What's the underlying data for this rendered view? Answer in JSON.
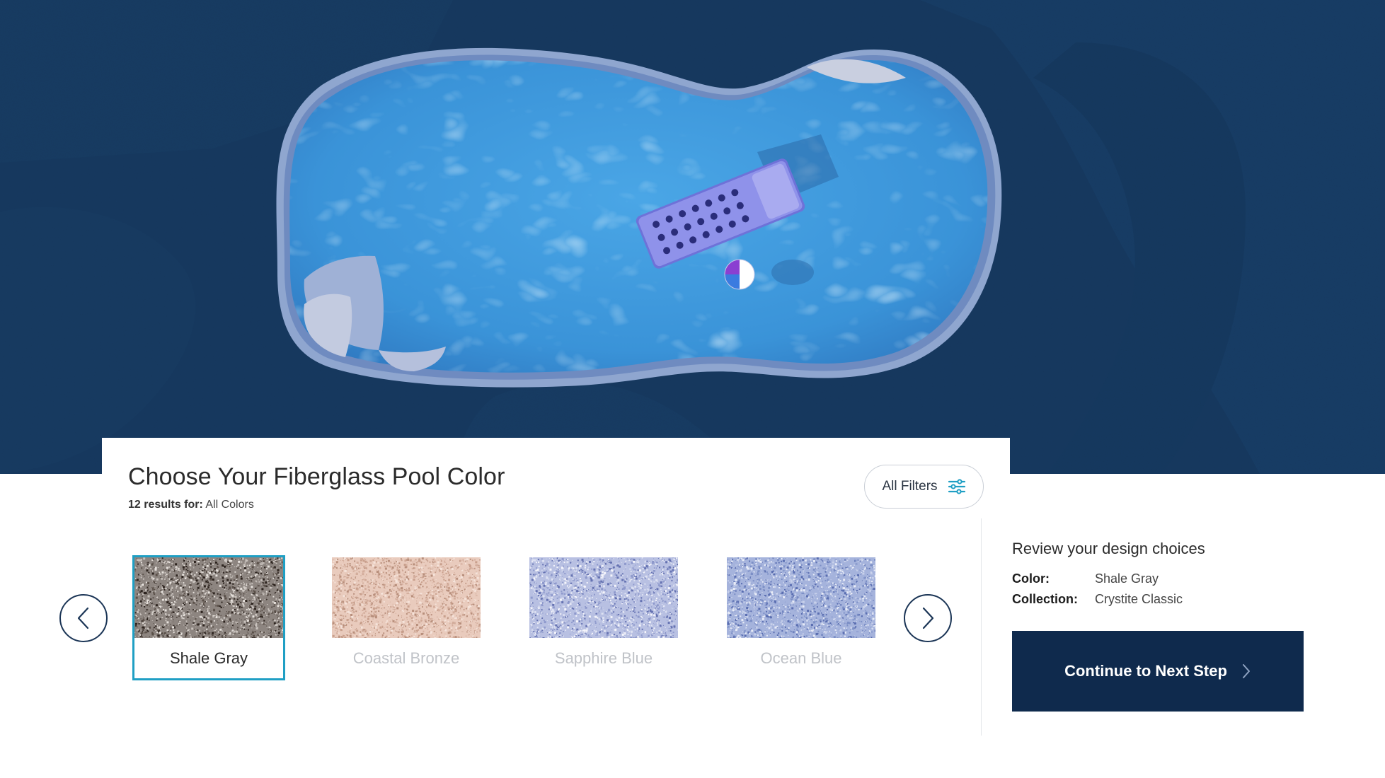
{
  "hero": {
    "image": "fiberglass-pool-aerial-view",
    "background_color": "#163a61"
  },
  "header": {
    "title": "Choose Your Fiberglass Pool Color",
    "results_count_label": "12 results for:",
    "results_filter_value": "All Colors",
    "filters_button_label": "All Filters",
    "filters_icon": "sliders-icon"
  },
  "carousel": {
    "prev_icon": "chevron-left-icon",
    "next_icon": "chevron-right-icon",
    "selected_border_color": "#1f9fc4",
    "swatches": [
      {
        "label": "Shale Gray",
        "selected": true,
        "colors": [
          "#2e2520",
          "#5a5049",
          "#8d8580",
          "#c9c2bd",
          "#e6e1dc"
        ]
      },
      {
        "label": "Coastal Bronze",
        "selected": false,
        "colors": [
          "#b88f7c",
          "#d3ad9c",
          "#e9cbbd",
          "#f5e3da",
          "#c9a08d"
        ]
      },
      {
        "label": "Sapphire Blue",
        "selected": false,
        "colors": [
          "#6673b2",
          "#8e99cc",
          "#b8c0e2",
          "#dde1f2",
          "#f5f5fb"
        ]
      },
      {
        "label": "Ocean Blue",
        "selected": false,
        "colors": [
          "#5a6eb1",
          "#7c8fc6",
          "#a5b3dc",
          "#c7d0ea",
          "#e8ecf7"
        ]
      }
    ]
  },
  "review": {
    "title": "Review your design choices",
    "color_label": "Color:",
    "color_value": "Shale Gray",
    "collection_label": "Collection:",
    "collection_value": "Crystite Classic"
  },
  "cta": {
    "label": "Continue to Next Step",
    "icon": "chevron-right-icon",
    "background_color": "#0f2a4d"
  }
}
